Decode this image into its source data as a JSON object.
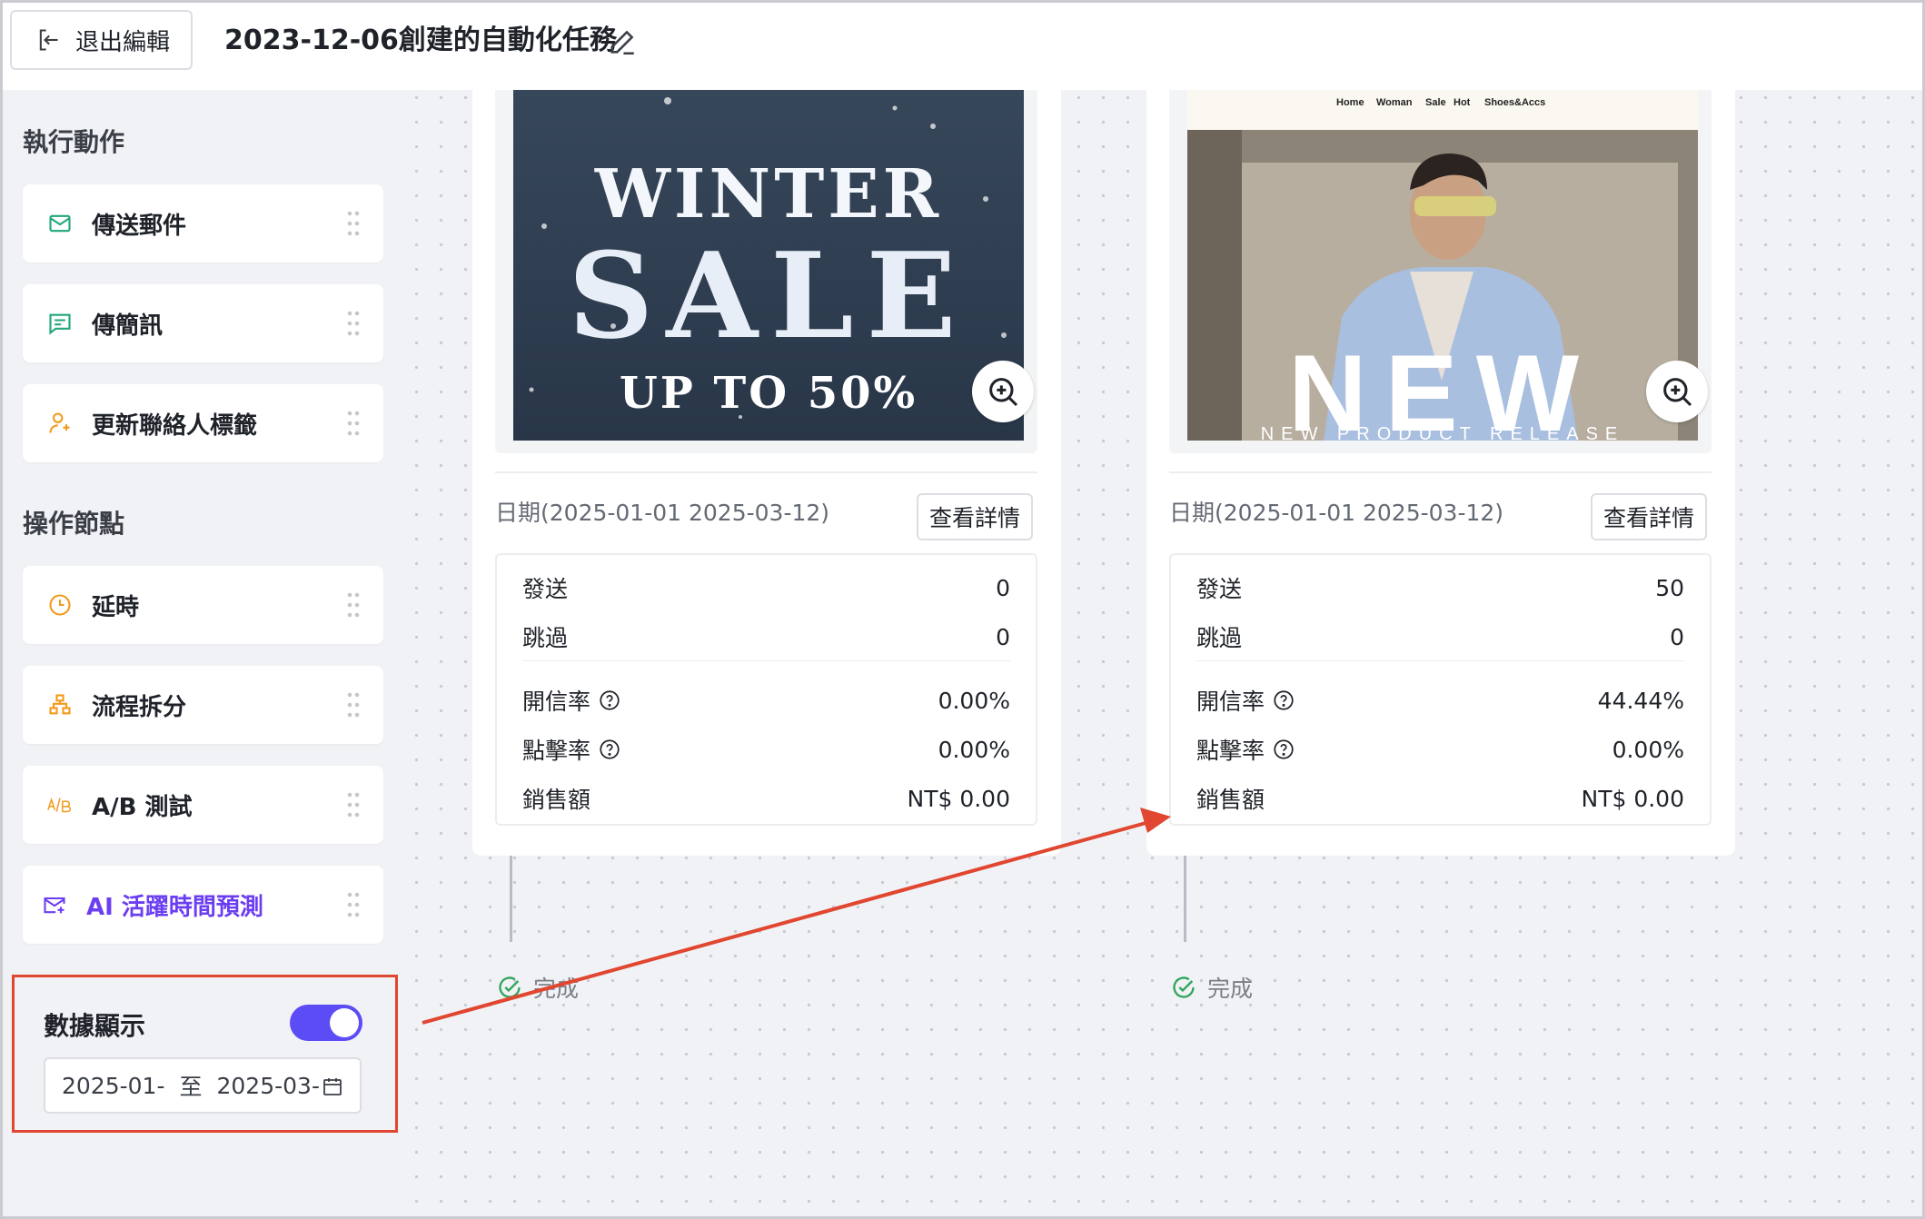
{
  "header": {
    "exit_label": "退出編輯",
    "title": "2023-12-06創建的自動化任務"
  },
  "sidebar": {
    "actions_title": "執行動作",
    "actions": [
      {
        "label": "傳送郵件",
        "icon": "mail-icon"
      },
      {
        "label": "傳簡訊",
        "icon": "message-icon"
      },
      {
        "label": "更新聯絡人標籤",
        "icon": "user-tag-icon"
      }
    ],
    "nodes_title": "操作節點",
    "nodes": [
      {
        "label": "延時",
        "icon": "clock-icon"
      },
      {
        "label": "流程拆分",
        "icon": "split-icon"
      },
      {
        "label": "A/B 測試",
        "icon": "ab-test-icon"
      },
      {
        "label": "AI 活躍時間預測",
        "icon": "ai-mail-icon"
      }
    ],
    "data_display": {
      "title": "數據顯示",
      "enabled": true,
      "start": "2025-01-",
      "separator": "至",
      "end": "2025-03-"
    }
  },
  "cards": [
    {
      "banner": {
        "line1": "WINTER",
        "line2": "SALE",
        "line3": "UP TO 50%"
      },
      "date_range": "日期(2025-01-01 2025-03-12)",
      "detail_label": "查看詳情",
      "stats": {
        "sent_label": "發送",
        "sent_value": "0",
        "skipped_label": "跳過",
        "skipped_value": "0",
        "open_rate_label": "開信率",
        "open_rate_value": "0.00%",
        "click_rate_label": "點擊率",
        "click_rate_value": "0.00%",
        "sales_label": "銷售額",
        "sales_value": "NT$ 0.00"
      },
      "status": "完成"
    },
    {
      "banner": {
        "nav": [
          "Home",
          "Woman",
          "Sale",
          "Hot",
          "Shoes&Accs"
        ],
        "big_text": "NEW",
        "caption": "NEW PRODUCT RELEASE"
      },
      "date_range": "日期(2025-01-01 2025-03-12)",
      "detail_label": "查看詳情",
      "stats": {
        "sent_label": "發送",
        "sent_value": "50",
        "skipped_label": "跳過",
        "skipped_value": "0",
        "open_rate_label": "開信率",
        "open_rate_value": "44.44%",
        "click_rate_label": "點擊率",
        "click_rate_value": "0.00%",
        "sales_label": "銷售額",
        "sales_value": "NT$ 0.00"
      },
      "status": "完成"
    }
  ],
  "colors": {
    "accent": "#5b4cf5",
    "highlight_border": "#e04630",
    "success": "#2fa65a",
    "icon_green": "#21a67a",
    "icon_orange": "#f29a1a",
    "ai_purple": "#6b3ef2"
  }
}
